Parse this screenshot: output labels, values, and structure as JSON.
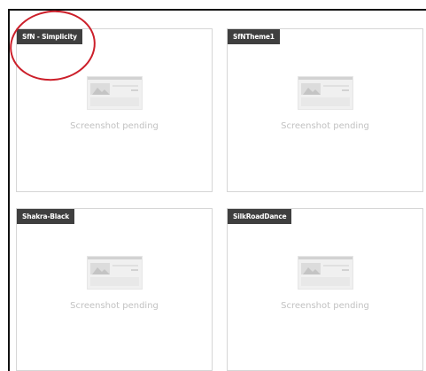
{
  "themes": [
    {
      "name": "SfN - Simplicity",
      "status": "Screenshot pending"
    },
    {
      "name": "SfNTheme1",
      "status": "Screenshot pending"
    },
    {
      "name": "Shakra-Black",
      "status": "Screenshot pending"
    },
    {
      "name": "SilkRoadDance",
      "status": "Screenshot pending"
    }
  ],
  "colors": {
    "label_background": "#3f3f3f",
    "label_text": "#ffffff",
    "card_border": "#d6d6d6",
    "placeholder_text": "#c2c2c2",
    "annotation": "#cc1f2a"
  },
  "icons": {
    "thumbnail": "screenshot-placeholder-icon"
  }
}
